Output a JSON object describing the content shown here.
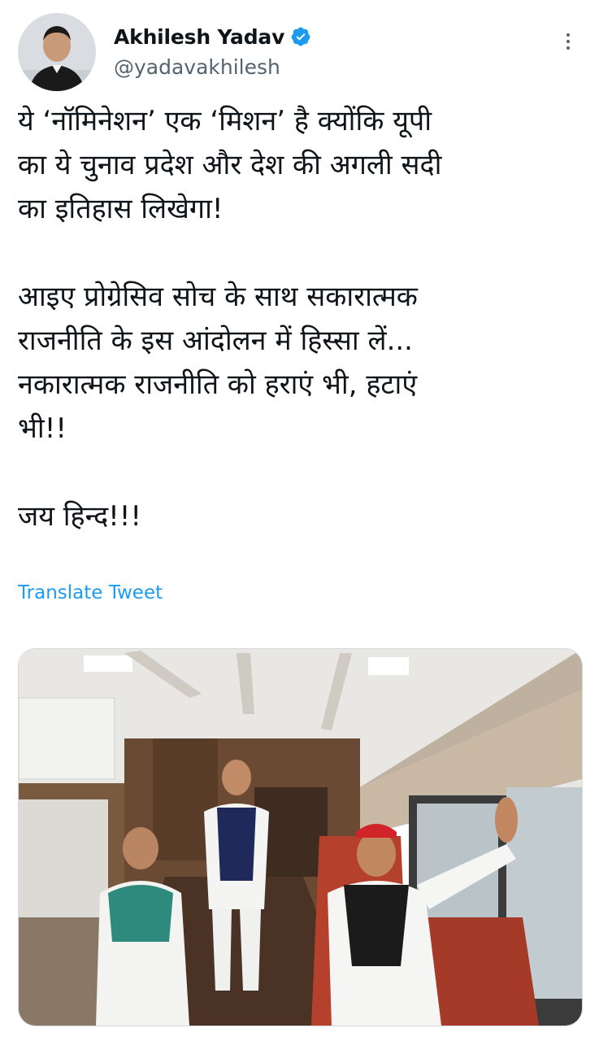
{
  "author": {
    "display_name": "Akhilesh Yadav",
    "handle": "@yadavakhilesh",
    "verified": true,
    "avatar_icon": "profile-photo"
  },
  "more_icon": "more-vertical-icon",
  "tweet": {
    "paragraph_1": "ये ‘नॉमिनेशन’ एक ‘मिशन’ है क्योंकि यूपी\nका ये चुनाव प्रदेश और देश की अगली सदी\nका इतिहास लिखेगा!",
    "paragraph_2": "आइए प्रोग्रेसिव सोच के साथ सकारात्मक\nराजनीति के इस आंदोलन में हिस्सा लें...\nनकारात्मक राजनीति को हराएं भी, हटाएं\nभी!!",
    "paragraph_3": "जय हिन्द!!!",
    "translate_label": "Translate Tweet"
  },
  "colors": {
    "link": "#1d9bf0",
    "verified": "#1d9bf0",
    "secondary_text": "#536471"
  }
}
